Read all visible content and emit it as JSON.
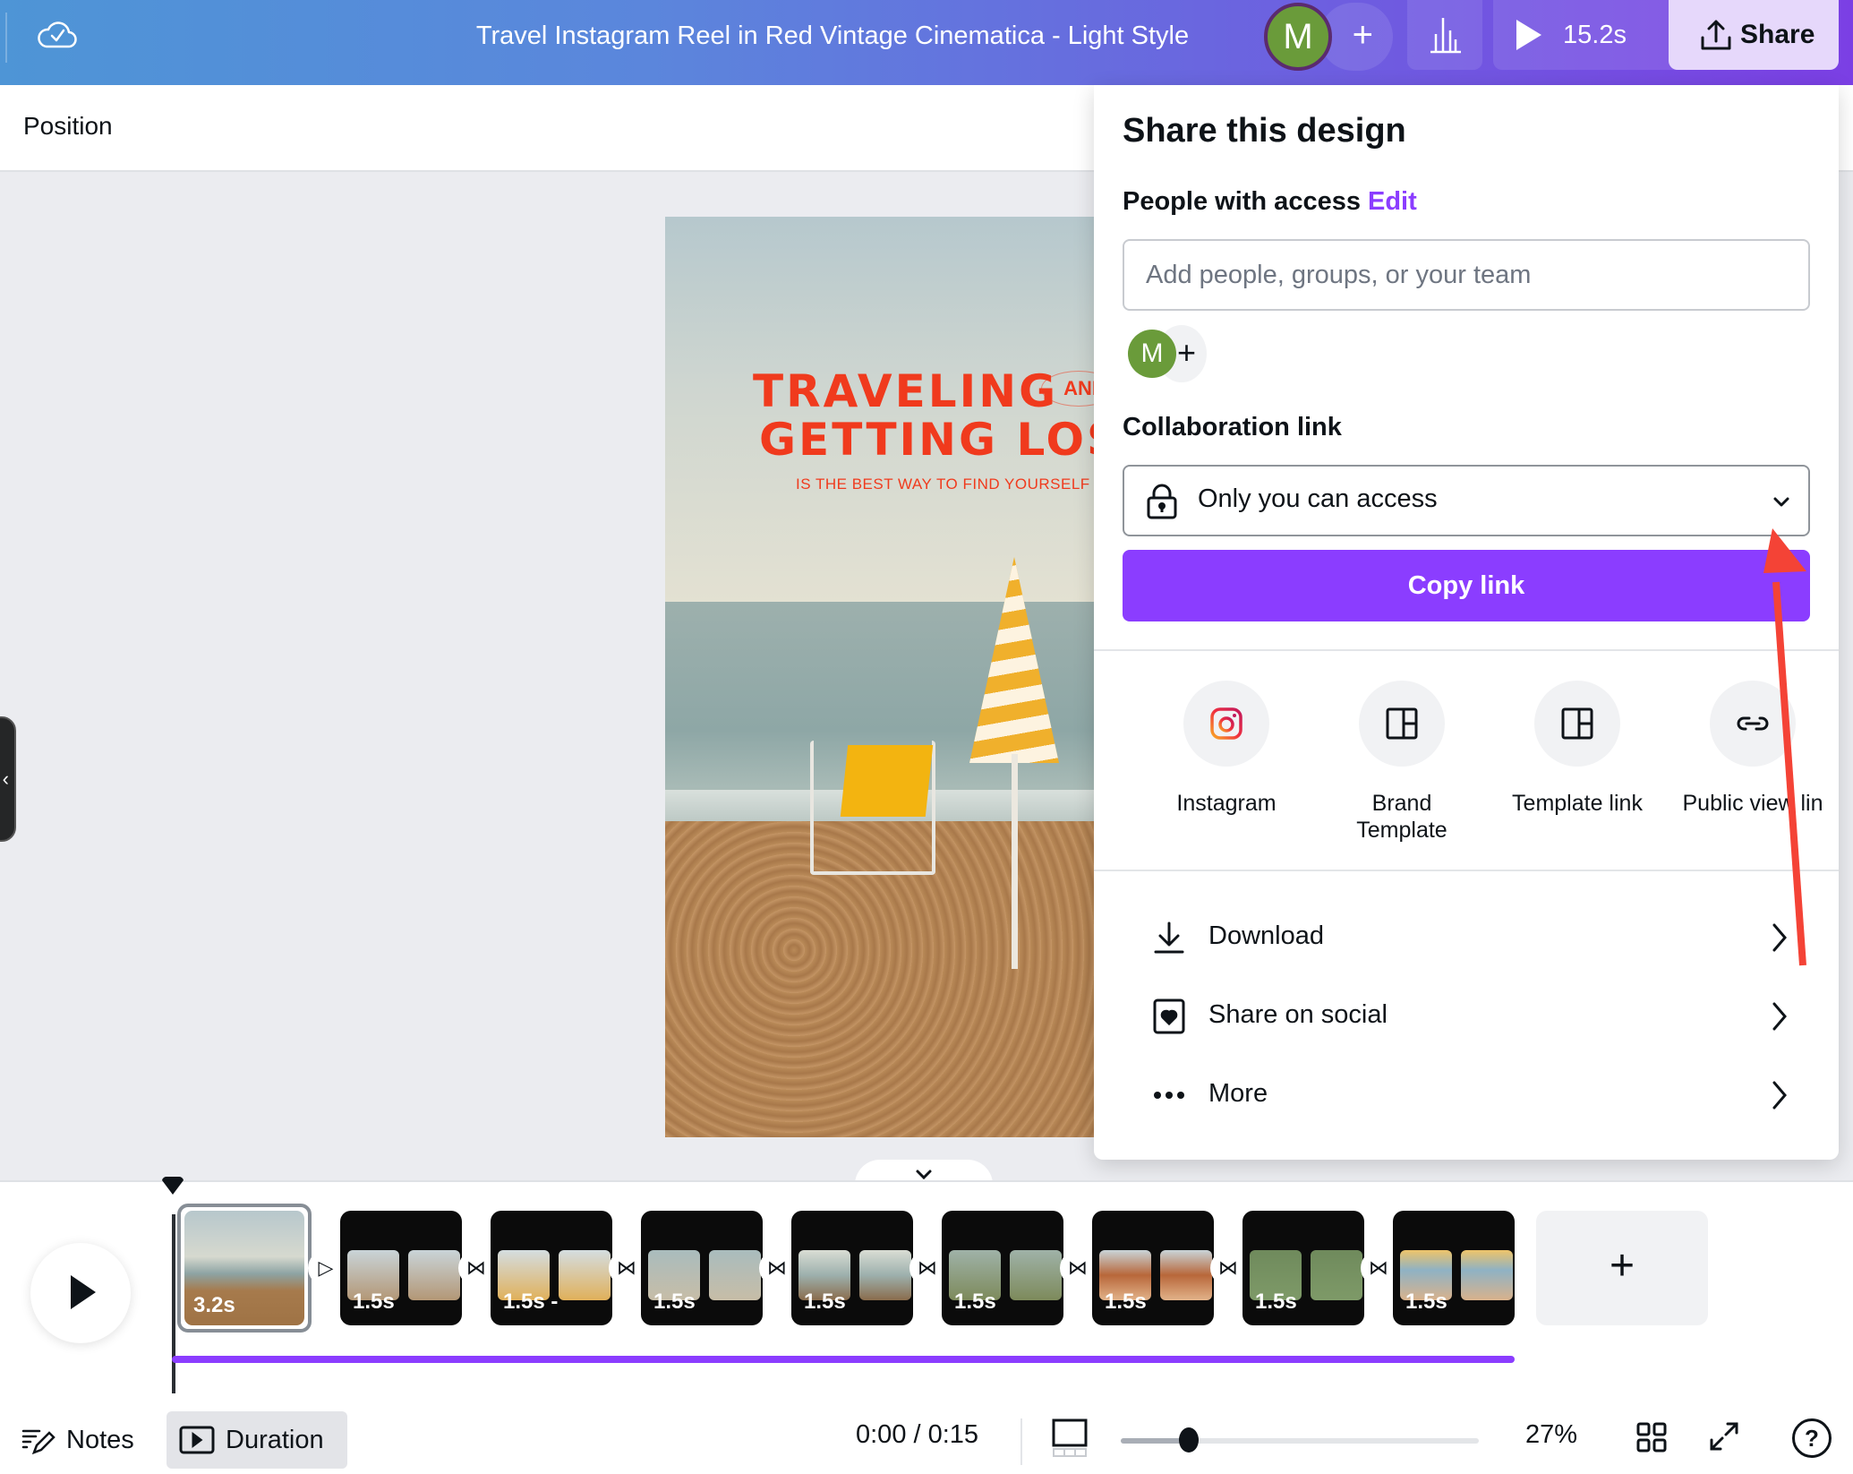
{
  "topbar": {
    "sync_icon": "cloud-check-icon",
    "title": "Travel Instagram Reel in Red Vintage Cinematica - Light Style",
    "avatar_initial": "M",
    "add_collaborator_label": "+",
    "insights_icon": "bar-chart-icon",
    "present_duration": "15.2s",
    "share_label": "Share"
  },
  "toolbar": {
    "position_label": "Position"
  },
  "canvas": {
    "headline_line1": "TRAVELING",
    "headline_and": "AND",
    "headline_line2": "GETTING LOST",
    "subheadline": "IS THE BEST WAY TO FIND YOURSELF"
  },
  "share_panel": {
    "title": "Share this design",
    "people_label": "People with access",
    "edit_label": "Edit",
    "people_input_placeholder": "Add people, groups, or your team",
    "people_input_value": "",
    "member_avatar_initial": "M",
    "add_member_label": "+",
    "collab_link_label": "Collaboration link",
    "access_option_selected": "Only you can access",
    "copy_link_label": "Copy link",
    "share_options": [
      {
        "label": "Instagram",
        "icon": "instagram-icon"
      },
      {
        "label": "Brand\nTemplate",
        "icon": "template-layout-icon"
      },
      {
        "label": "Template link",
        "icon": "template-layout-icon"
      },
      {
        "label": "Public view lin",
        "icon": "link-icon"
      }
    ],
    "actions": [
      {
        "label": "Download",
        "icon": "download-icon"
      },
      {
        "label": "Share on social",
        "icon": "heart-card-icon"
      },
      {
        "label": "More",
        "icon": "more-dots-icon"
      }
    ],
    "colors": {
      "accent": "#8b3dff",
      "annotation": "#f44336"
    }
  },
  "timeline": {
    "clips": [
      {
        "duration": "3.2s",
        "selected": true
      },
      {
        "duration": "1.5s"
      },
      {
        "duration": "1.5s -"
      },
      {
        "duration": "1.5s"
      },
      {
        "duration": "1.5s"
      },
      {
        "duration": "1.5s"
      },
      {
        "duration": "1.5s"
      },
      {
        "duration": "1.5s"
      },
      {
        "duration": "1.5s"
      }
    ],
    "transitions": [
      "slide-icon",
      "bowtie-icon",
      "bowtie-icon",
      "bowtie-icon",
      "bowtie-icon",
      "bowtie-icon",
      "bowtie-icon",
      "bowtie-icon"
    ],
    "add_page_label": "+"
  },
  "bottombar": {
    "notes_label": "Notes",
    "duration_label": "Duration",
    "time_readout": "0:00 / 0:15",
    "zoom_percent_label": "27%",
    "zoom_slider_fraction": 0.19,
    "help_label": "?"
  }
}
